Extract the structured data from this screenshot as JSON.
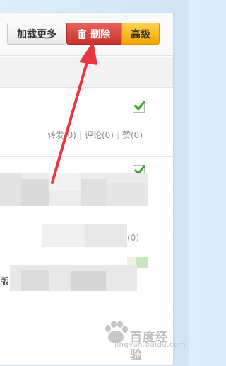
{
  "toolbar": {
    "load_more_label": "加载更多",
    "delete_label": "删除",
    "advanced_label": "高级",
    "delete_icon": "trash-icon"
  },
  "posts": [
    {
      "checked": true,
      "actions": {
        "forward_label": "转发(0)",
        "comment_label": "评论(0)",
        "like_label": "赞(0)"
      }
    },
    {
      "checked": true,
      "partial_action": "(0)",
      "partial_text": "版"
    }
  ],
  "annotation": {
    "arrow_color": "#e8383d"
  },
  "watermark": {
    "text_cn": "百度经验",
    "text_en": "jingyan.baidu.com",
    "logo": "baidu-paw-logo"
  }
}
